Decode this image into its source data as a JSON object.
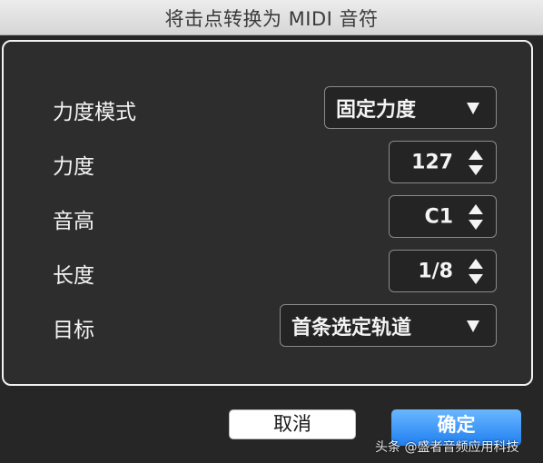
{
  "window": {
    "title": "将击点转换为 MIDI 音符"
  },
  "form": {
    "velocity_mode": {
      "label": "力度模式",
      "value": "固定力度",
      "icon": "chevron-down-icon"
    },
    "velocity": {
      "label": "力度",
      "value": "127",
      "icon": "stepper-icon"
    },
    "pitch": {
      "label": "音高",
      "value": "C1",
      "icon": "stepper-icon"
    },
    "length": {
      "label": "长度",
      "value": "1/8",
      "icon": "stepper-icon"
    },
    "target": {
      "label": "目标",
      "value": "首条选定轨道",
      "icon": "chevron-down-icon"
    }
  },
  "buttons": {
    "cancel": "取消",
    "ok": "确定"
  },
  "watermark": "头条 @盛者音频应用科技",
  "colors": {
    "accent": "#2a8cff",
    "panel_border": "#f2f2f2",
    "background": "#262626"
  }
}
